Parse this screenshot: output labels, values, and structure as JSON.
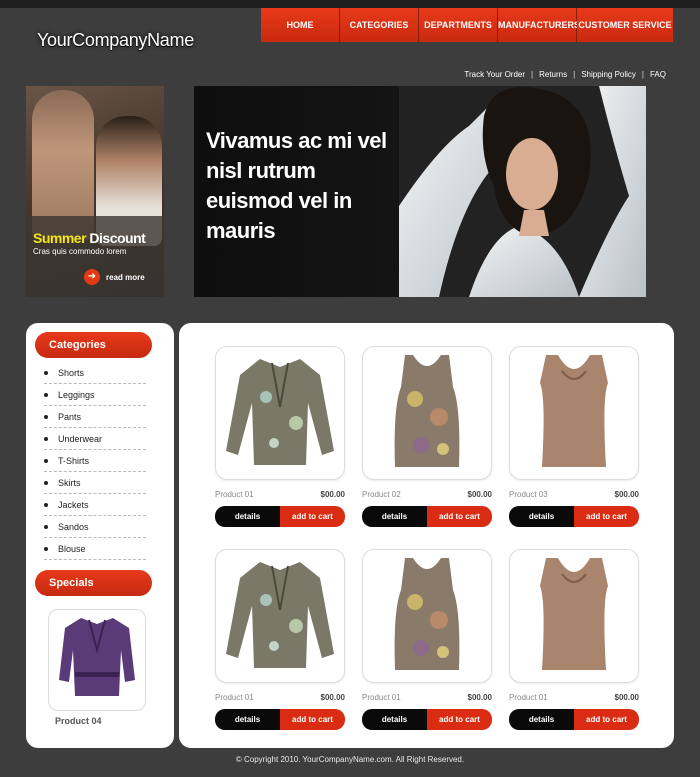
{
  "brand": {
    "logo": "YourCompanyName"
  },
  "nav": [
    {
      "label": "HOME"
    },
    {
      "label": "CATEGORIES"
    },
    {
      "label": "DEPARTMENTS"
    },
    {
      "label": "MANUFACTURERS"
    },
    {
      "label": "CUSTOMER SERVICE"
    }
  ],
  "toplinks": [
    {
      "label": "Track Your Order"
    },
    {
      "label": "Returns"
    },
    {
      "label": "Shipping Policy"
    },
    {
      "label": "FAQ"
    }
  ],
  "promo": {
    "title_highlight": "Summer",
    "title_rest": " Discount",
    "subtitle": "Cras quis commodo lorem",
    "read_more": "read more"
  },
  "hero": {
    "headline": "Vivamus ac mi vel nisl rutrum euismod vel in mauris"
  },
  "sidebar": {
    "categories_title": "Categories",
    "categories": [
      "Shorts",
      "Leggings",
      "Pants",
      "Underwear",
      "T-Shirts",
      "Skirts",
      "Jackets",
      "Sandos",
      "Blouse"
    ],
    "specials_title": "Specials",
    "special_product": "Product 04"
  },
  "products": [
    {
      "name": "Product 01",
      "price": "$00.00",
      "details": "details",
      "cart": "add to cart",
      "icon": "jacket-icon"
    },
    {
      "name": "Product 02",
      "price": "$00.00",
      "details": "details",
      "cart": "add to cart",
      "icon": "tank-top-icon"
    },
    {
      "name": "Product 03",
      "price": "$00.00",
      "details": "details",
      "cart": "add to cart",
      "icon": "blouse-icon"
    },
    {
      "name": "Product 01",
      "price": "$00.00",
      "details": "details",
      "cart": "add to cart",
      "icon": "jacket-icon"
    },
    {
      "name": "Product 01",
      "price": "$00.00",
      "details": "details",
      "cart": "add to cart",
      "icon": "tank-top-icon"
    },
    {
      "name": "Product 01",
      "price": "$00.00",
      "details": "details",
      "cart": "add to cart",
      "icon": "blouse-icon"
    }
  ],
  "footer": {
    "copyright": "© Copyright 2010. YourCompanyName.com. All Right Reserved."
  },
  "colors": {
    "accent": "#d92c12",
    "background": "#3d3d3d",
    "button_dark": "#0a0a0a"
  }
}
